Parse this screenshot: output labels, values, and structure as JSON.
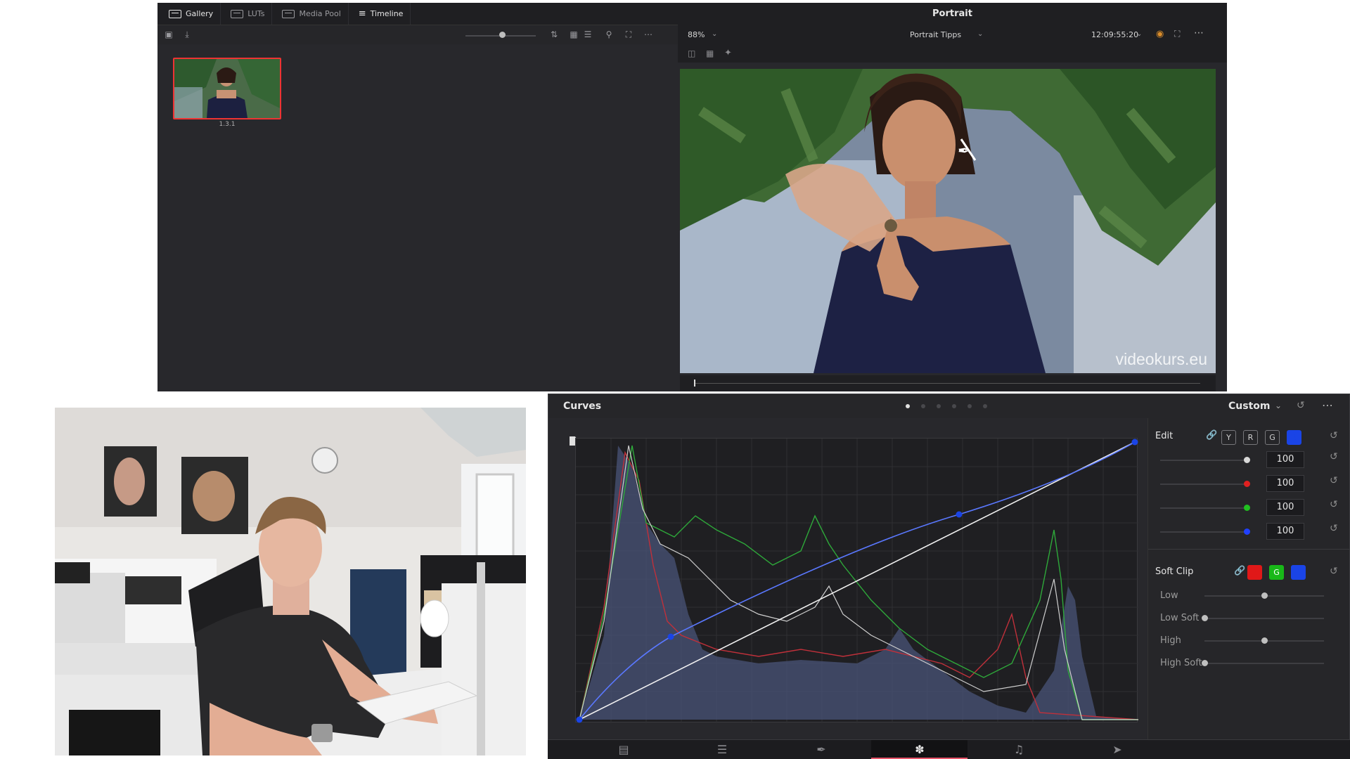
{
  "top_window": {
    "tabs": [
      {
        "label": "Gallery",
        "icon": "gallery-icon",
        "active": true
      },
      {
        "label": "LUTs",
        "icon": "luts-icon",
        "active": false
      },
      {
        "label": "Media Pool",
        "icon": "media-pool-icon",
        "active": false
      },
      {
        "label": "Timeline",
        "icon": "timeline-icon",
        "active": true
      }
    ],
    "viewer_title": "Portrait",
    "still_label": "1.3.1",
    "zoom": "88%",
    "clip_name": "Portrait Tipps",
    "timecode": "12:09:55:20",
    "watermark": "videokurs.eu"
  },
  "curves": {
    "title": "Curves",
    "mode": "Custom",
    "edit_label": "Edit",
    "channels": [
      "Y",
      "R",
      "G",
      "B"
    ],
    "active_channel": "B",
    "intensity_values": [
      {
        "channel": "Y",
        "value": "100",
        "color": "#d8d8d8"
      },
      {
        "channel": "R",
        "value": "100",
        "color": "#e02020"
      },
      {
        "channel": "G",
        "value": "100",
        "color": "#20c020"
      },
      {
        "channel": "B",
        "value": "100",
        "color": "#2040ff"
      }
    ],
    "soft_clip_label": "Soft Clip",
    "soft_clip_buttons": [
      {
        "label": "R",
        "color": "#e01818"
      },
      {
        "label": "G",
        "color": "#18b818"
      },
      {
        "label": "B",
        "color": "#1a44e6"
      }
    ],
    "soft_clip_params": [
      {
        "label": "Low",
        "level": 0.5
      },
      {
        "label": "Low Soft",
        "level": 0.0
      },
      {
        "label": "High",
        "level": 0.5
      },
      {
        "label": "High Soft",
        "level": 0.0
      }
    ]
  },
  "colors": {
    "panel_bg": "#28282c",
    "accent_blue": "#1a44e6",
    "selection_red": "#e33333",
    "color_page_accent": "#e8556a"
  },
  "pages": [
    {
      "name": "cut",
      "icon": "cut-page-icon"
    },
    {
      "name": "edit",
      "icon": "edit-page-icon"
    },
    {
      "name": "fusion",
      "icon": "fusion-page-icon"
    },
    {
      "name": "color",
      "icon": "color-page-icon",
      "active": true
    },
    {
      "name": "fairlight",
      "icon": "fairlight-page-icon"
    },
    {
      "name": "deliver",
      "icon": "deliver-page-icon"
    }
  ]
}
